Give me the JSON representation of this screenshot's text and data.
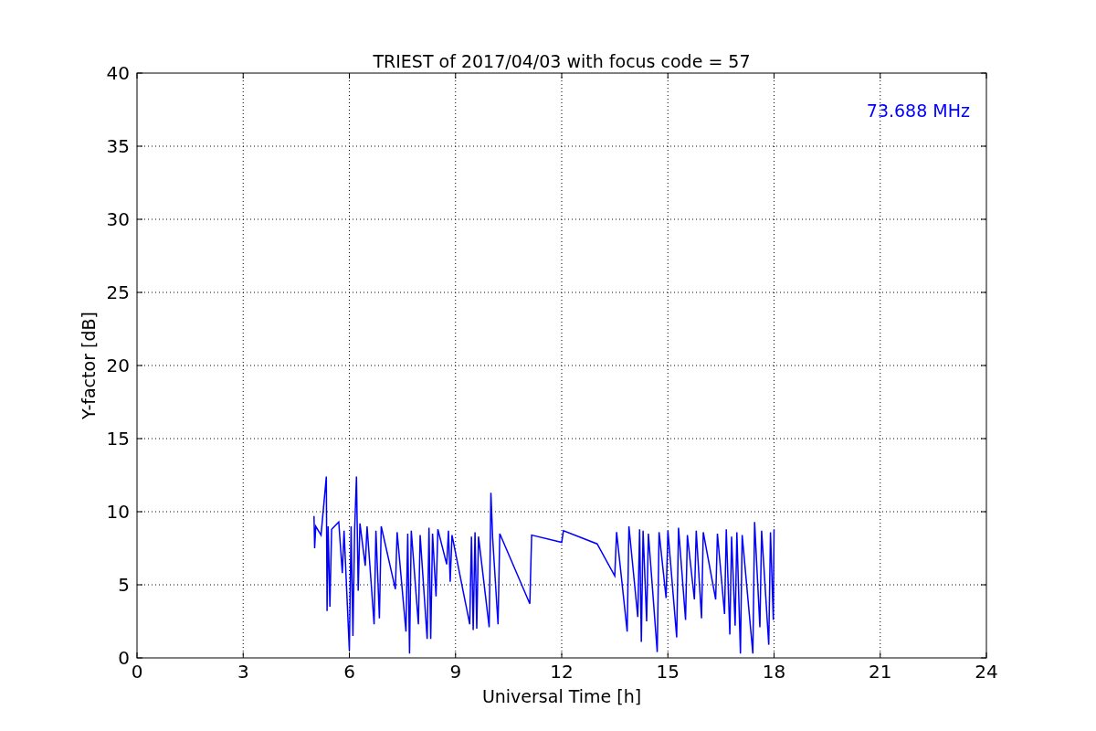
{
  "chart": {
    "chart_data": {
      "type": "line",
      "title": "TRIEST of 2017/04/03 with focus code = 57",
      "xlabel": "Universal Time [h]",
      "ylabel": "Y-factor [dB]",
      "xlim": [
        0,
        24
      ],
      "ylim": [
        0,
        40
      ],
      "xticks": [
        0,
        3,
        6,
        9,
        12,
        15,
        18,
        21,
        24
      ],
      "yticks": [
        0,
        5,
        10,
        15,
        20,
        25,
        30,
        35,
        40
      ],
      "grid": true,
      "series": [
        {
          "name": "73.688 MHz",
          "color": "#0000ff",
          "x": [
            5.0,
            5.02,
            5.05,
            5.2,
            5.35,
            5.37,
            5.4,
            5.45,
            5.5,
            5.7,
            5.8,
            5.85,
            6.0,
            6.05,
            6.1,
            6.15,
            6.2,
            6.25,
            6.3,
            6.45,
            6.5,
            6.7,
            6.75,
            6.85,
            6.9,
            7.3,
            7.35,
            7.6,
            7.65,
            7.7,
            7.75,
            7.95,
            8.0,
            8.2,
            8.25,
            8.3,
            8.35,
            8.45,
            8.5,
            8.75,
            8.8,
            8.85,
            8.9,
            9.4,
            9.45,
            9.5,
            9.55,
            9.6,
            9.65,
            9.95,
            10.0,
            10.05,
            10.2,
            10.25,
            11.1,
            11.15,
            12.0,
            12.05,
            13.0,
            13.5,
            13.55,
            13.85,
            13.9,
            14.15,
            14.2,
            14.25,
            14.3,
            14.4,
            14.45,
            14.7,
            14.75,
            14.95,
            15.0,
            15.25,
            15.3,
            15.5,
            15.55,
            15.75,
            15.8,
            15.95,
            16.0,
            16.35,
            16.4,
            16.6,
            16.65,
            16.75,
            16.8,
            16.9,
            16.95,
            17.05,
            17.1,
            17.4,
            17.45,
            17.6,
            17.65,
            17.85,
            17.9,
            17.98,
            18.0
          ],
          "values": [
            9.7,
            7.5,
            9.0,
            8.4,
            12.4,
            3.2,
            9.0,
            3.5,
            8.8,
            9.3,
            5.8,
            8.7,
            0.5,
            9.0,
            1.5,
            8.8,
            12.4,
            4.6,
            9.2,
            6.3,
            9.0,
            2.3,
            8.7,
            2.7,
            9.0,
            4.7,
            8.6,
            1.8,
            8.5,
            0.3,
            8.7,
            2.3,
            8.4,
            1.3,
            8.9,
            1.3,
            8.5,
            4.2,
            8.8,
            6.4,
            8.7,
            5.2,
            8.4,
            2.3,
            8.3,
            1.9,
            8.6,
            2.0,
            8.3,
            2.1,
            11.3,
            8.2,
            2.3,
            8.5,
            3.7,
            8.4,
            7.9,
            8.7,
            7.8,
            5.6,
            8.6,
            1.8,
            9.0,
            2.8,
            8.8,
            1.1,
            8.7,
            2.5,
            8.5,
            0.4,
            8.6,
            4.1,
            8.7,
            1.4,
            8.9,
            2.6,
            8.4,
            4.0,
            8.7,
            2.7,
            8.6,
            4.0,
            8.5,
            3.0,
            8.8,
            1.6,
            8.3,
            2.2,
            8.6,
            0.3,
            8.4,
            0.3,
            9.3,
            2.1,
            8.7,
            0.9,
            8.6,
            2.6,
            8.8
          ]
        }
      ]
    }
  }
}
